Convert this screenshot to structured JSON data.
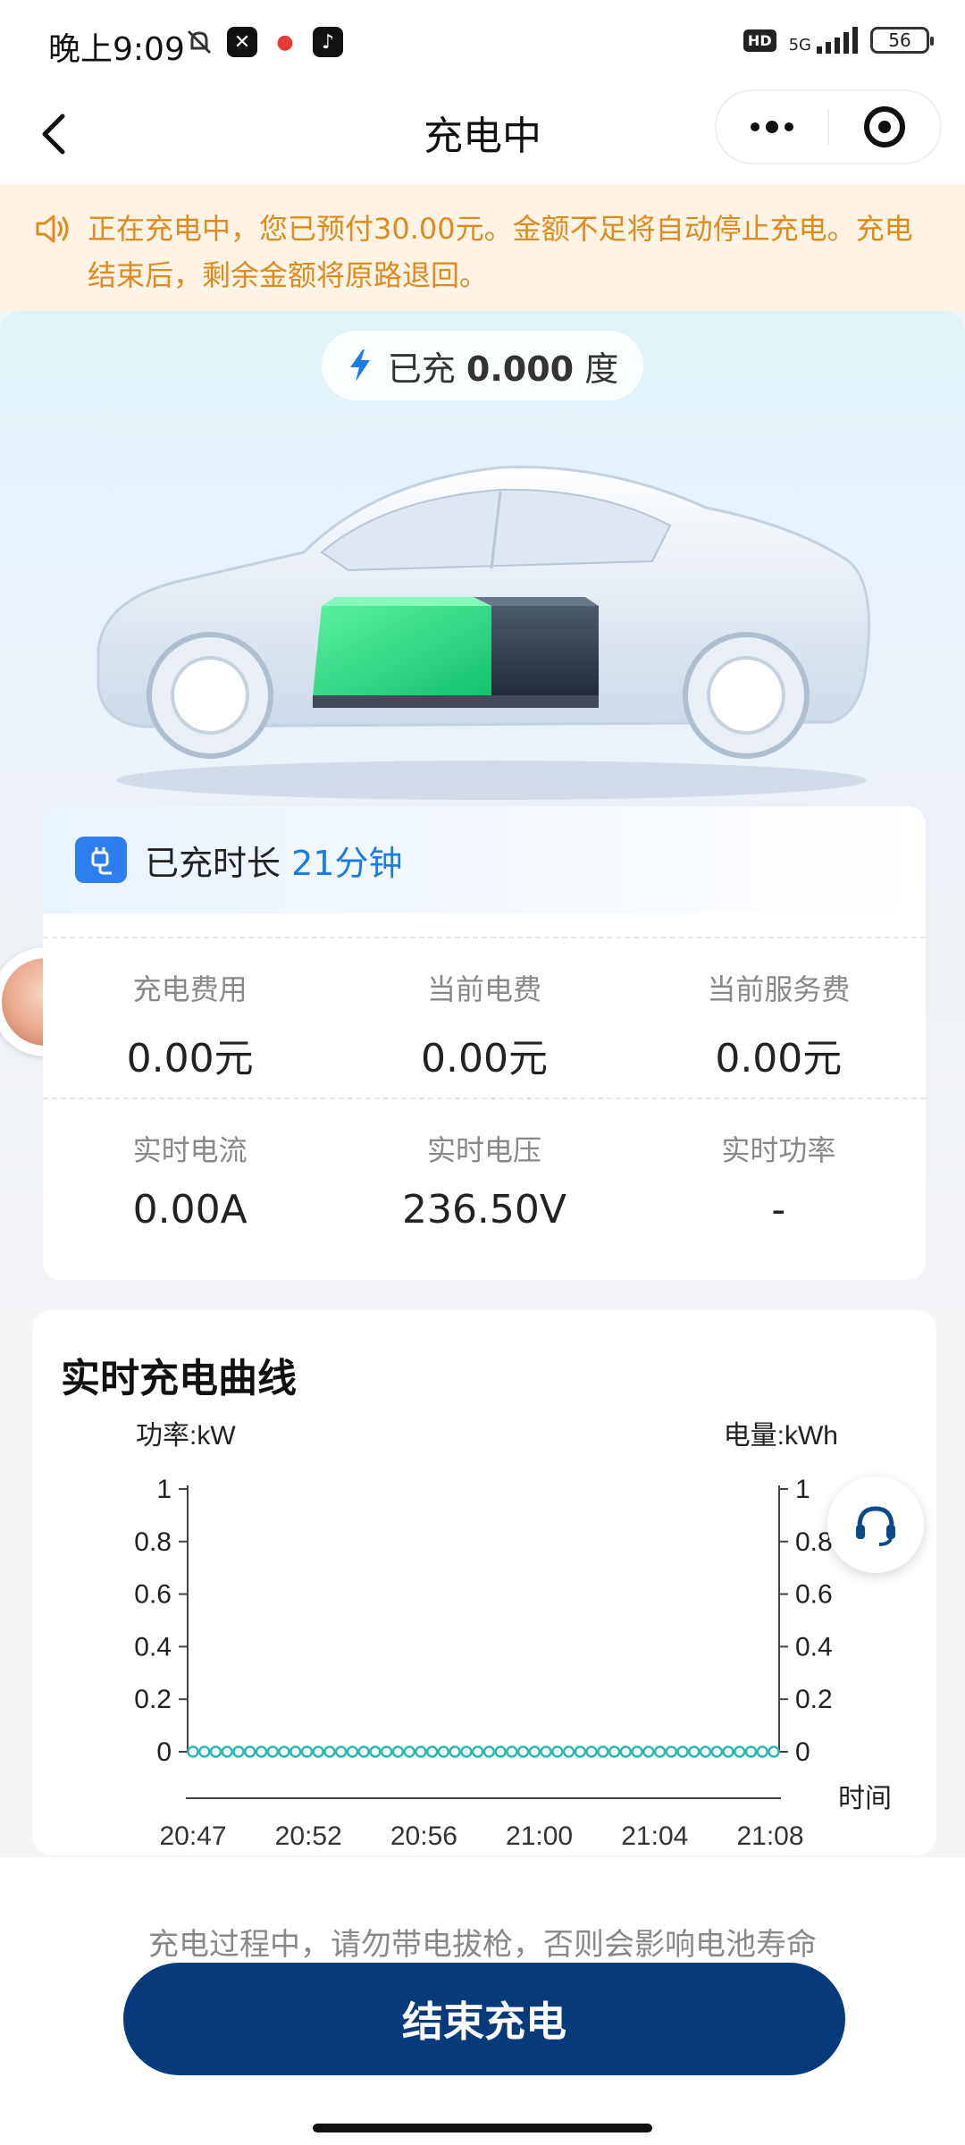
{
  "status_bar": {
    "time": "晚上9:09",
    "network": "5G",
    "hd": "HD",
    "battery": "56"
  },
  "nav": {
    "title": "充电中"
  },
  "notice": {
    "text": "正在充电中，您已预付30.00元。金额不足将自动停止充电。充电结束后，剩余金额将原路退回。"
  },
  "hero": {
    "charged_prefix": "已充",
    "charged_value": "0.000",
    "charged_unit": "度"
  },
  "duration": {
    "label": "已充时长",
    "value": "21分钟"
  },
  "stats": {
    "row1": [
      {
        "label": "充电费用",
        "value": "0.00元"
      },
      {
        "label": "当前电费",
        "value": "0.00元"
      },
      {
        "label": "当前服务费",
        "value": "0.00元"
      }
    ],
    "row2": [
      {
        "label": "实时电流",
        "value": "0.00A"
      },
      {
        "label": "实时电压",
        "value": "236.50V"
      },
      {
        "label": "实时功率",
        "value": "-"
      }
    ]
  },
  "chart": {
    "title": "实时充电曲线"
  },
  "chart_data": {
    "type": "line",
    "ylabel_left": "功率:kW",
    "ylabel_right": "电量:kWh",
    "xlabel": "时间",
    "y_ticks": [
      "1",
      "0.8",
      "0.6",
      "0.4",
      "0.2",
      "0"
    ],
    "ylim": [
      0,
      1
    ],
    "x_ticks": [
      "20:47",
      "20:52",
      "20:56",
      "21:00",
      "21:04",
      "21:08"
    ],
    "series": [
      {
        "color": "#2bb7b3",
        "values": [
          0,
          0,
          0,
          0,
          0,
          0,
          0,
          0,
          0,
          0,
          0,
          0,
          0,
          0,
          0,
          0,
          0,
          0,
          0,
          0,
          0,
          0,
          0,
          0,
          0,
          0,
          0,
          0,
          0,
          0,
          0,
          0,
          0,
          0,
          0,
          0,
          0,
          0,
          0,
          0,
          0,
          0,
          0,
          0,
          0,
          0,
          0,
          0,
          0,
          0,
          0,
          0
        ]
      }
    ],
    "grid": false
  },
  "footer": {
    "warning": "充电过程中，请勿带电拔枪，否则会影响电池寿命",
    "end_button": "结束充电"
  }
}
